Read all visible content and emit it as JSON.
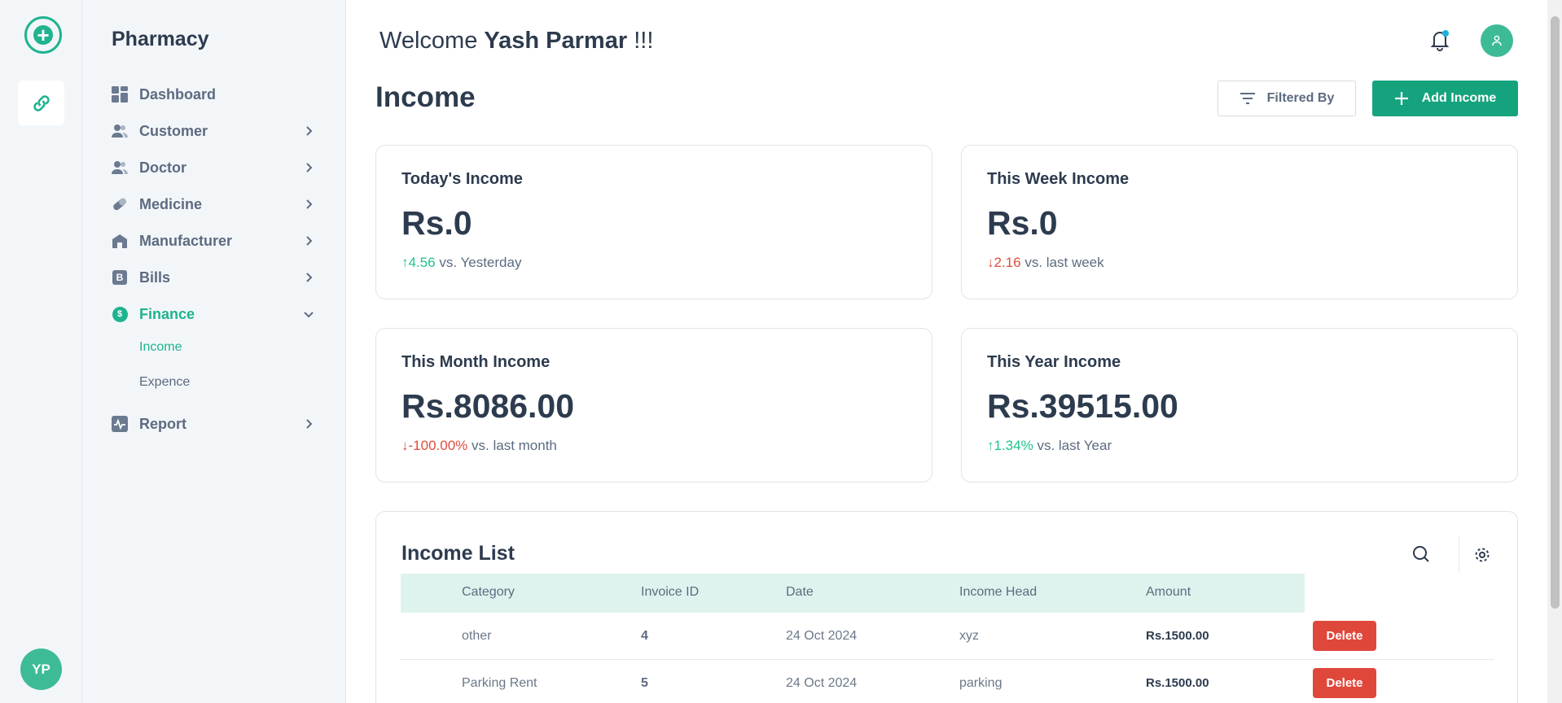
{
  "app": {
    "brand": "Pharmacy",
    "avatar_initials": "YP"
  },
  "header": {
    "welcome_prefix": "Welcome",
    "user_name": "Yash Parmar",
    "welcome_suffix": "!!!"
  },
  "sidebar": {
    "items": [
      {
        "label": "Dashboard",
        "icon": "dashboard-grid-icon"
      },
      {
        "label": "Customer",
        "icon": "users-icon"
      },
      {
        "label": "Doctor",
        "icon": "users-icon"
      },
      {
        "label": "Medicine",
        "icon": "pill-icon"
      },
      {
        "label": "Manufacturer",
        "icon": "building-icon"
      },
      {
        "label": "Bills",
        "icon": "bill-icon",
        "glyph": "B"
      },
      {
        "label": "Finance",
        "icon": "dollar-icon",
        "glyph": "$"
      },
      {
        "label": "Report",
        "icon": "activity-icon"
      }
    ],
    "finance_sub": [
      "Income",
      "Expence"
    ]
  },
  "page": {
    "title": "Income",
    "filter_label": "Filtered By",
    "add_label": "Add Income"
  },
  "stats": [
    {
      "label": "Today's Income",
      "value": "Rs.0",
      "change": "4.56",
      "direction": "up",
      "suffix": "vs. Yesterday"
    },
    {
      "label": "This Week Income",
      "value": "Rs.0",
      "change": "2.16",
      "direction": "down",
      "suffix": "vs. last week"
    },
    {
      "label": "This Month Income",
      "value": "Rs.8086.00",
      "change": "-100.00%",
      "direction": "down",
      "suffix": "vs. last month"
    },
    {
      "label": "This Year Income",
      "value": "Rs.39515.00",
      "change": "1.34%",
      "direction": "up",
      "suffix": "vs. last Year"
    }
  ],
  "income_list": {
    "title": "Income List",
    "columns": [
      "Category",
      "Invoice ID",
      "Date",
      "Income Head",
      "Amount"
    ],
    "delete_label": "Delete",
    "rows": [
      {
        "category": "other",
        "invoice_id": "4",
        "date": "24 Oct 2024",
        "income_head": "xyz",
        "amount": "Rs.1500.00"
      },
      {
        "category": "Parking Rent",
        "invoice_id": "5",
        "date": "24 Oct 2024",
        "income_head": "parking",
        "amount": "Rs.1500.00"
      }
    ]
  },
  "colors": {
    "accent": "#1fb38f",
    "primary_button": "#15a37d",
    "danger": "#e0473b",
    "up": "#1fc38e",
    "down": "#e04b3f"
  }
}
